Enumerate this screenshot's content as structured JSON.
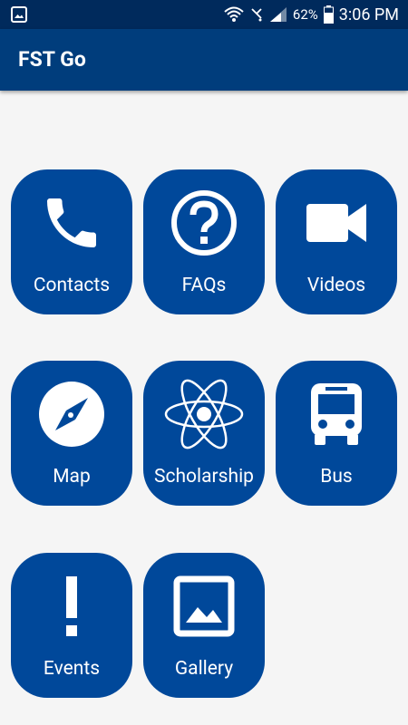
{
  "status_bar": {
    "battery_percent": "62%",
    "time": "3:06 PM",
    "icons": [
      "image-notification-icon",
      "wifi-icon",
      "no-signal-icon",
      "cell-signal-icon",
      "battery-icon"
    ]
  },
  "app_bar": {
    "title": "FST Go"
  },
  "colors": {
    "status_bar": "#002a5c",
    "app_bar": "#003d7c",
    "tile": "#00489a",
    "background": "#f5f5f5",
    "icon": "#ffffff"
  },
  "tiles": [
    {
      "label": "Contacts",
      "icon": "phone-icon"
    },
    {
      "label": "FAQs",
      "icon": "help-circle-icon"
    },
    {
      "label": "Videos",
      "icon": "video-camera-icon"
    },
    {
      "label": "Map",
      "icon": "compass-icon"
    },
    {
      "label": "Scholarship",
      "icon": "atom-icon"
    },
    {
      "label": "Bus",
      "icon": "bus-icon"
    },
    {
      "label": "Events",
      "icon": "exclamation-icon"
    },
    {
      "label": "Gallery",
      "icon": "image-icon"
    }
  ]
}
